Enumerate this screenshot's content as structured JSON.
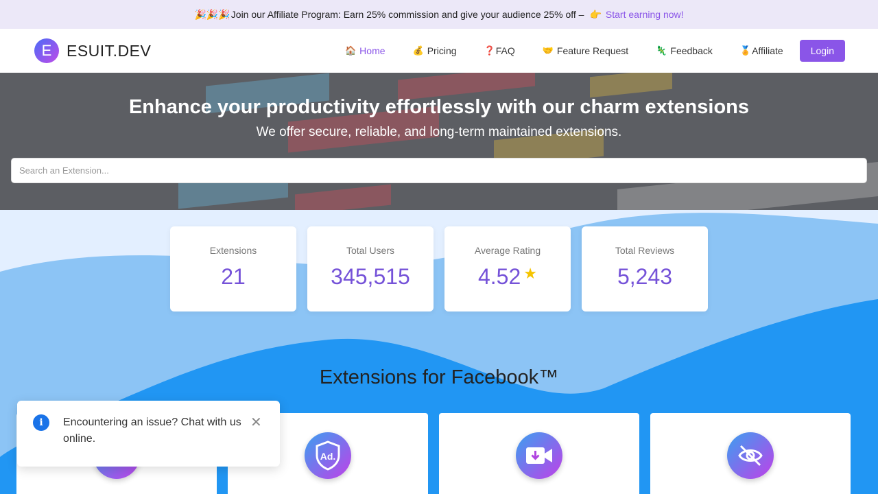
{
  "announcement": {
    "emojis": "🎉🎉🎉",
    "text": "Join our Affiliate Program: Earn 25% commission and give your audience 25% off –",
    "pointer": "👉",
    "link": "Start earning now!"
  },
  "brand": {
    "badge": "E",
    "name": "ESUIT.DEV"
  },
  "nav": {
    "items": [
      {
        "icon": "🏠",
        "label": "Home"
      },
      {
        "icon": "💰",
        "label": "Pricing"
      },
      {
        "icon": "❓",
        "label": "FAQ"
      },
      {
        "icon": "🤝",
        "label": "Feature Request"
      },
      {
        "icon": "🦎",
        "label": "Feedback"
      },
      {
        "icon": "🏅",
        "label": "Affiliate"
      }
    ],
    "login": "Login"
  },
  "hero": {
    "title": "Enhance your productivity effortlessly with our charm extensions",
    "subtitle": "We offer secure, reliable, and long-term maintained extensions.",
    "search_placeholder": "Search an Extension..."
  },
  "stats": [
    {
      "label": "Extensions",
      "value": "21"
    },
    {
      "label": "Total Users",
      "value": "345,515"
    },
    {
      "label": "Average Rating",
      "value": "4.52",
      "star": "★"
    },
    {
      "label": "Total Reviews",
      "value": "5,243"
    }
  ],
  "section": {
    "title": "Extensions for Facebook™"
  },
  "cards": [
    {
      "icon": "extension-icon"
    },
    {
      "icon": "ad-shield-icon",
      "icon_text": "Ad."
    },
    {
      "icon": "video-download-icon"
    },
    {
      "icon": "eye-off-icon"
    }
  ],
  "toast": {
    "icon": "i",
    "message": "Encountering an issue? Chat with us online.",
    "close": "✕"
  },
  "colors": {
    "accent": "#8a55e8",
    "blue": "#2196f3",
    "light_blue": "#8cc4f5",
    "stat_value": "#7552d8"
  }
}
